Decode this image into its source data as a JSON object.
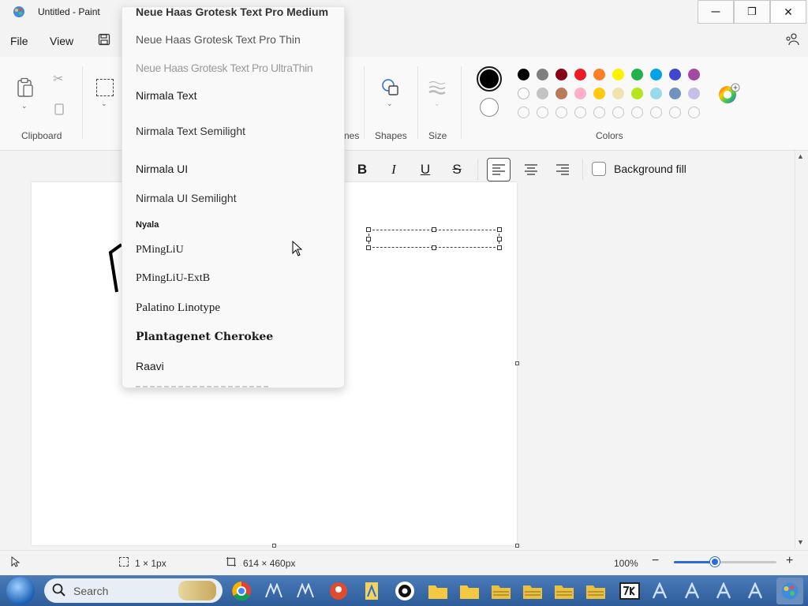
{
  "window": {
    "title": "Untitled - Paint",
    "minimize_glyph": "—",
    "restore_glyph": "❐",
    "close_glyph": "✕"
  },
  "menu": {
    "file": "File",
    "view": "View"
  },
  "ribbon": {
    "groups": {
      "clipboard": "Clipboard",
      "shapes_partial": "nes",
      "shapes": "Shapes",
      "size": "Size",
      "colors": "Colors"
    },
    "palette_row1": [
      "#000000",
      "#7f7f7f",
      "#880015",
      "#ed1c24",
      "#ff7f27",
      "#fff200",
      "#22b14c",
      "#00a2e8",
      "#3f48cc",
      "#a349a4"
    ],
    "palette_row2": [
      "#ffffff",
      "#c3c3c3",
      "#b97a57",
      "#ffaec9",
      "#ffc90e",
      "#efe4b0",
      "#b5e61d",
      "#99d9ea",
      "#7092be",
      "#c8bfe7"
    ],
    "primary_color": "#000000",
    "secondary_color": "#ffffff"
  },
  "text_toolbar": {
    "bold": "B",
    "italic": "I",
    "underline": "U",
    "strikethrough": "S",
    "background_fill": "Background fill",
    "align_active": "left"
  },
  "font_dropdown": {
    "items": [
      "Neue Haas Grotesk Text Pro Medium",
      "Neue Haas Grotesk Text Pro Thin",
      "Neue Haas Grotesk Text Pro UltraThin",
      "Nirmala Text",
      "Nirmala Text Semilight",
      "Nirmala UI",
      "Nirmala UI Semilight",
      "Nyala",
      "PMingLiU",
      "PMingLiU-ExtB",
      "Palatino Linotype",
      "Plantagenet Cherokee",
      "Raavi"
    ]
  },
  "status": {
    "selection_size": "1 × 1px",
    "canvas_size": "614 × 460px",
    "zoom": "100%",
    "zoom_level": 0.4
  },
  "taskbar": {
    "search_placeholder": "Search"
  }
}
